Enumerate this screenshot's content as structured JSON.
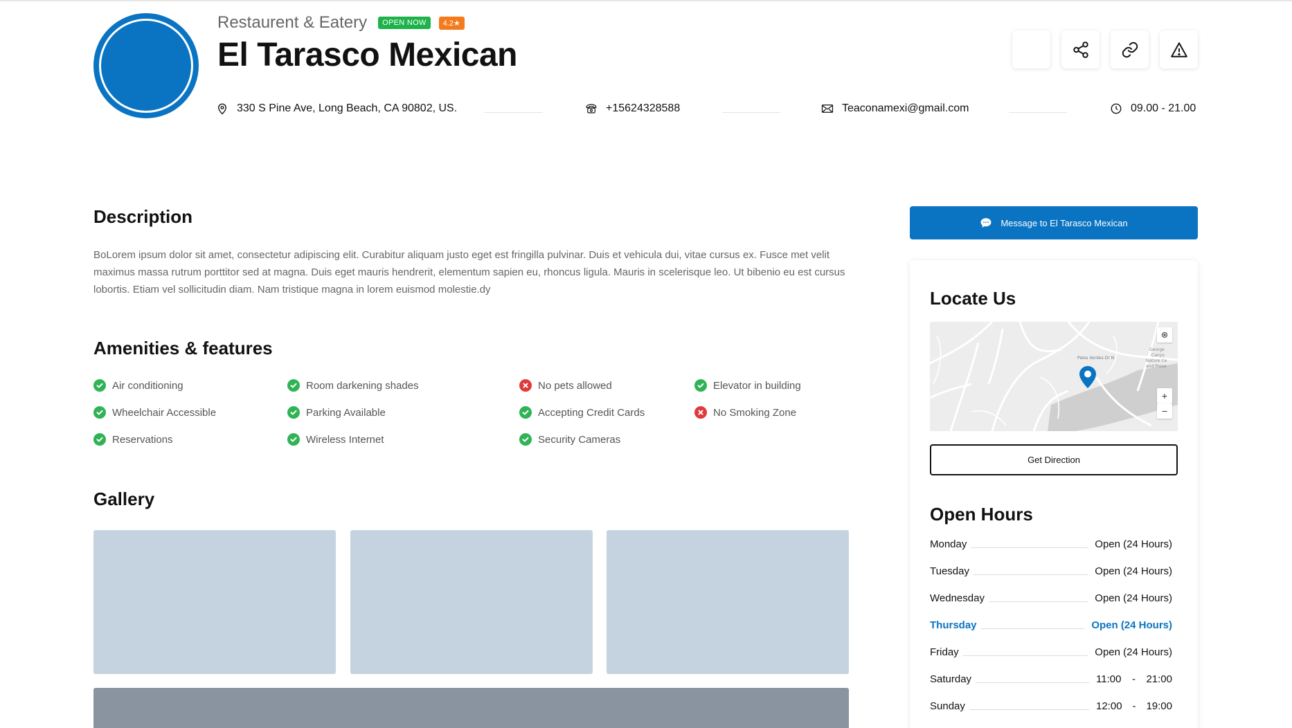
{
  "header": {
    "category": "Restaurent & Eatery",
    "open_badge": "OPEN NOW",
    "rating_badge": "4.2★",
    "business_name": "El Tarasco Mexican",
    "address": "330 S Pine Ave, Long Beach, CA 90802, US.",
    "phone": "+15624328588",
    "email": "Teaconamexi@gmail.com",
    "hours_summary": "09.00 - 21.00",
    "actions": [
      "bookmark-icon",
      "share-icon",
      "link-icon",
      "report-icon"
    ]
  },
  "description": {
    "title": "Description",
    "text": "BoLorem ipsum dolor sit amet, consectetur adipiscing elit. Curabitur aliquam justo eget est fringilla pulvinar. Duis et vehicula dui, vitae cursus ex. Fusce met velit maximus massa rutrum porttitor sed at magna. Duis eget mauris hendrerit, elementum sapien eu, rhoncus ligula. Mauris in scelerisque leo. Ut bibenio eu est cursus lobortis. Etiam vel sollicitudin diam. Nam tristique magna in lorem euismod molestie.dy"
  },
  "amenities": {
    "title": "Amenities & features",
    "items": [
      {
        "label": "Air conditioning",
        "available": true
      },
      {
        "label": "Wheelchair Accessible",
        "available": true
      },
      {
        "label": "Reservations",
        "available": true
      },
      {
        "label": "Room darkening shades",
        "available": true
      },
      {
        "label": "Parking Available",
        "available": true
      },
      {
        "label": "Wireless Internet",
        "available": true
      },
      {
        "label": "No pets allowed",
        "available": false
      },
      {
        "label": "Accepting Credit Cards",
        "available": true
      },
      {
        "label": "Security Cameras",
        "available": true
      },
      {
        "label": "Elevator in building",
        "available": true
      },
      {
        "label": "No Smoking Zone",
        "available": false
      }
    ]
  },
  "gallery": {
    "title": "Gallery"
  },
  "sidebar": {
    "message_button": "Message to El Tarasco Mexican",
    "locate_title": "Locate Us",
    "map_labels": [
      "Palos Verdes Dr N",
      "George Canyo Nature Ce and Prese"
    ],
    "get_direction": "Get Direction",
    "hours_title": "Open Hours",
    "hours": [
      {
        "day": "Monday",
        "value": "Open (24 Hours)"
      },
      {
        "day": "Tuesday",
        "value": "Open (24 Hours)"
      },
      {
        "day": "Wednesday",
        "value": "Open (24 Hours)"
      },
      {
        "day": "Thursday",
        "value": "Open (24 Hours)",
        "active": true
      },
      {
        "day": "Friday",
        "value": "Open (24 Hours)"
      },
      {
        "day": "Saturday",
        "open": "11:00",
        "sep": "-",
        "close": "21:00"
      },
      {
        "day": "Sunday",
        "open": "12:00",
        "sep": "-",
        "close": "19:00"
      }
    ]
  },
  "colors": {
    "primary": "#0a74c2",
    "open_badge": "#1db34a",
    "rating_badge": "#f47a1c",
    "available": "#2fb354",
    "unavailable": "#e03a3a"
  }
}
